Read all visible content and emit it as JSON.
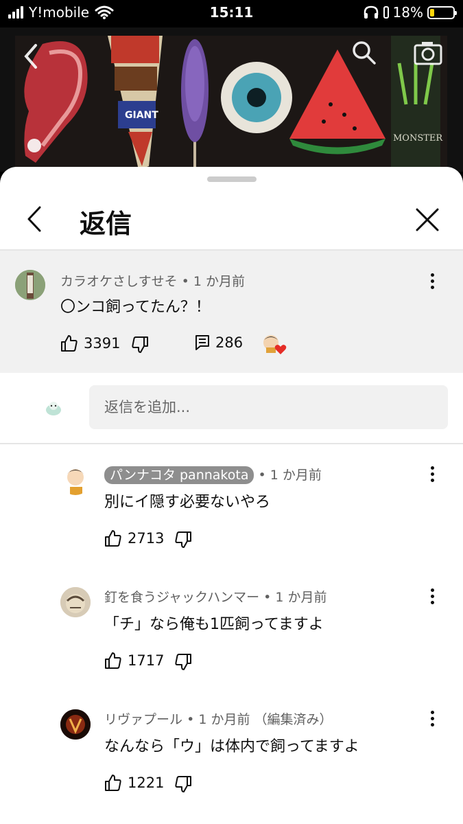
{
  "status_bar": {
    "carrier": "Y!mobile",
    "time": "15:11",
    "battery_percent_label": "18%",
    "battery_level": 0.18
  },
  "sheet": {
    "title": "返信"
  },
  "parent_comment": {
    "author": "カラオケさしすせそ",
    "age": "1 か月前",
    "text": "〇ンコ飼ってたん？！",
    "likes": "3391",
    "reply_count": "286"
  },
  "reply_input": {
    "placeholder": "返信を追加..."
  },
  "replies": [
    {
      "author": "パンナコタ pannakota",
      "age": "1 か月前",
      "edited": "",
      "text": "別にイ隠す必要ないやろ",
      "likes": "2713"
    },
    {
      "author": "釘を食うジャックハンマー",
      "age": "1 か月前",
      "edited": "",
      "text": "「チ」なら俺も1匹飼ってますよ",
      "likes": "1717"
    },
    {
      "author": "リヴァプール",
      "age": "1 か月前",
      "edited": "（編集済み）",
      "text": "なんなら「ウ」は体内で飼ってますよ",
      "likes": "1221"
    }
  ],
  "video": {
    "brand_text": "MONSTER"
  },
  "icons": {
    "back": "chevron-left-icon",
    "close": "close-icon",
    "like": "thumb-up-icon",
    "dislike": "thumb-down-icon",
    "replies": "comment-icon",
    "search": "search-icon",
    "camera": "camera-icon"
  },
  "colors": {
    "heart": "#e52d27",
    "author_badge": "#8e8e8e",
    "battery": "#ffd60a"
  }
}
